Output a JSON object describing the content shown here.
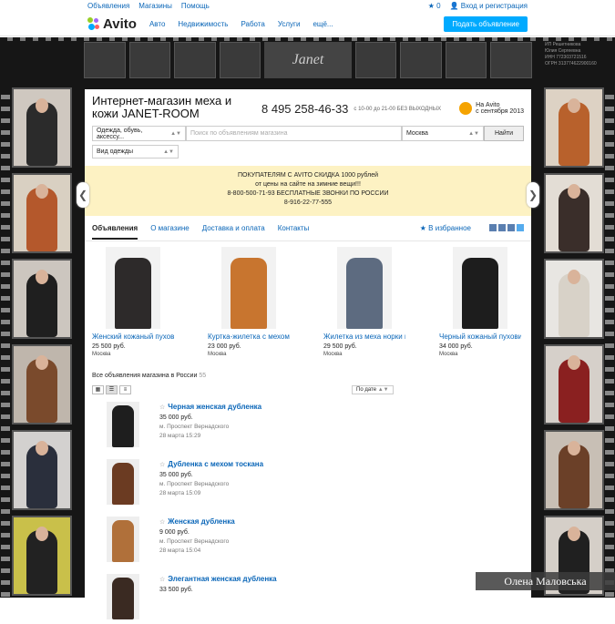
{
  "topbar": {
    "links": [
      "Объявления",
      "Магазины",
      "Помощь"
    ],
    "fav_count": "0",
    "login": "Вход и регистрация"
  },
  "header": {
    "logo": "Avito",
    "nav": [
      "Авто",
      "Недвижимость",
      "Работа",
      "Услуги",
      "ещё..."
    ],
    "post_button": "Подать объявление"
  },
  "banner": {
    "brand": "Janet",
    "side_text": [
      "ИП Решетникова",
      "Юлия Сергеевна",
      "ИНН 772303721516",
      "ОГРН 313774622900160"
    ]
  },
  "shop": {
    "name": "Интернет-магазин меха и кожи JANET-ROOM",
    "phone": "8 495 258-46-33",
    "hours": "с 10-00 до 21-00 БЕЗ ВЫХОДНЫХ",
    "since_line1": "На Avito",
    "since_line2": "с сентября 2013"
  },
  "search": {
    "category": "Одежда, обувь, аксессу...",
    "placeholder": "Поиск по объявлениям магазина",
    "city": "Москва",
    "button": "Найти",
    "filter": "Вид одежды"
  },
  "promo": [
    "ПОКУПАТЕЛЯМ С AVITO СКИДКА 1000 рублей",
    "от цены на сайте на зимние вещи!!!",
    "8-800-500-71-93 БЕСПЛАТНЫЕ ЗВОНКИ ПО РОССИИ",
    "8-916-22-77-555"
  ],
  "tabs": [
    "Объявления",
    "О магазине",
    "Доставка и оплата",
    "Контакты"
  ],
  "favorites": "В избранное",
  "carousel": [
    {
      "title": "Женский кожаный пуховик",
      "price": "25 500 руб.",
      "city": "Москва",
      "color": "#2d2a2a"
    },
    {
      "title": "Куртка-жилетка с мехом лисы",
      "price": "23 000 руб.",
      "city": "Москва",
      "color": "#c8752f"
    },
    {
      "title": "Жилетка из меха норки и чернобурки. Новинка",
      "price": "29 500 руб.",
      "city": "Москва",
      "color": "#5d6b80"
    },
    {
      "title": "Черный кожаный пуховик мехом чернобурки. Нови",
      "price": "34 000 руб.",
      "city": "Москва",
      "color": "#1d1d1d"
    }
  ],
  "listing": {
    "header": "Все объявления магазина в России",
    "count": "55",
    "sort": "По дате",
    "items": [
      {
        "title": "Черная женская дубленка",
        "price": "35 000 руб.",
        "metro": "м. Проспект Вернадского",
        "date": "28 марта 15:29",
        "color": "#1e1e1e"
      },
      {
        "title": "Дубленка с мехом тоскана",
        "price": "35 000 руб.",
        "metro": "м. Проспект Вернадского",
        "date": "28 марта 15:09",
        "color": "#6b3b22"
      },
      {
        "title": "Женская дубленка",
        "price": "9 000 руб.",
        "metro": "м. Проспект Вернадского",
        "date": "28 марта 15:04",
        "color": "#b0703a"
      },
      {
        "title": "Элегантная женская дубленка",
        "price": "33 500 руб.",
        "metro": "",
        "date": "",
        "color": "#3a2a22"
      }
    ]
  },
  "signature": "Олена Маловська",
  "colors": {
    "accent": "#00aaff",
    "link": "#0a66b8",
    "promo_bg": "#fdf2c3"
  }
}
